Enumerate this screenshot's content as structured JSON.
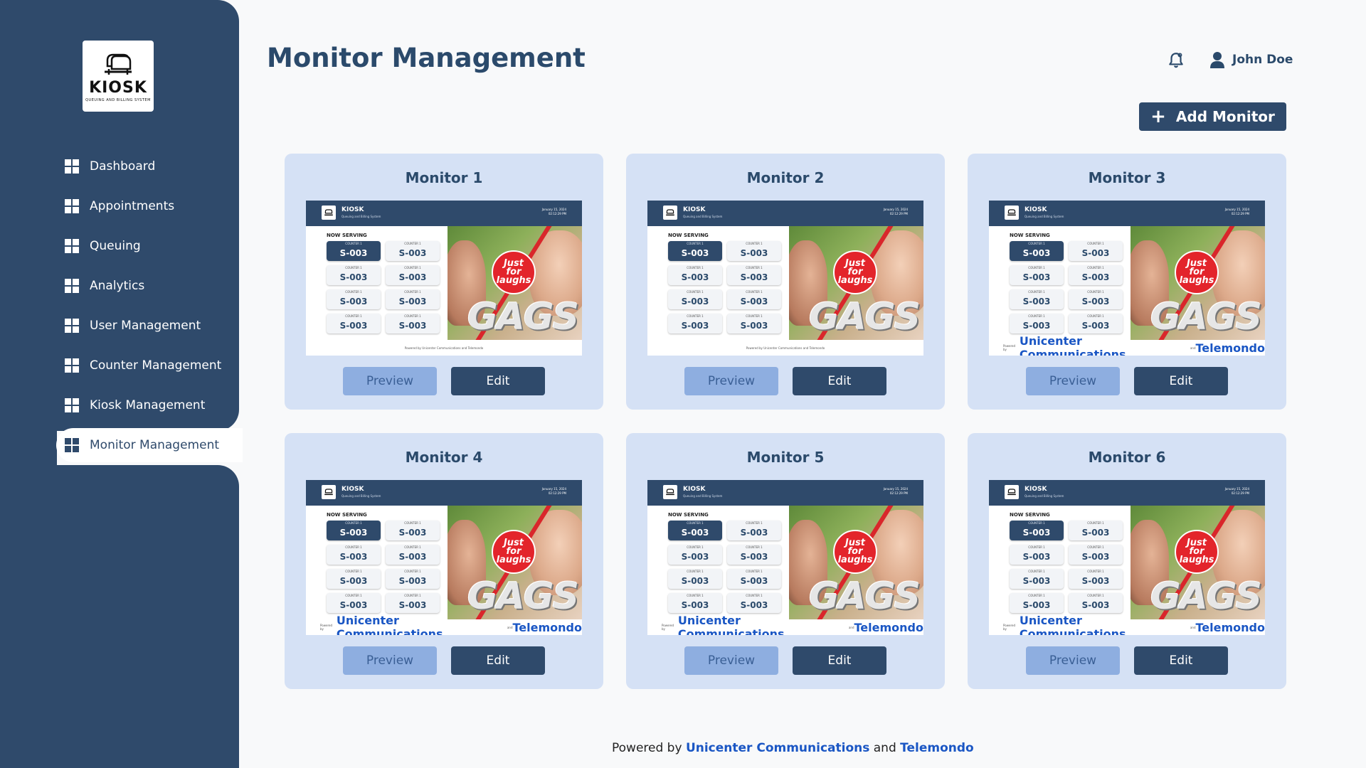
{
  "logo": {
    "word": "KIOSK",
    "tagline": "QUEUING AND BILLING SYSTEM"
  },
  "sidebar": {
    "items": [
      {
        "label": "Dashboard",
        "icon": "grid-icon"
      },
      {
        "label": "Appointments",
        "icon": "grid-icon"
      },
      {
        "label": "Queuing",
        "icon": "grid-icon"
      },
      {
        "label": "Analytics",
        "icon": "grid-icon"
      },
      {
        "label": "User Management",
        "icon": "grid-icon"
      },
      {
        "label": "Counter Management",
        "icon": "grid-icon"
      },
      {
        "label": "Kiosk Management",
        "icon": "grid-icon"
      },
      {
        "label": "Monitor Management",
        "icon": "grid-icon",
        "active": true
      }
    ]
  },
  "header": {
    "title": "Monitor Management",
    "user_name": "John Doe",
    "add_button": "Add Monitor"
  },
  "monitor_preview": {
    "brand": "KIOSK",
    "brand_sub": "Queuing and Billing System",
    "date": "January 15, 2024",
    "time": "02:12:29 PM",
    "now_serving": "NOW SERVING",
    "counter_label": "COUNTER 1",
    "ticket": "S-003",
    "ad_text_1": "Just",
    "ad_text_2": "for",
    "ad_text_3": "laughs",
    "ad_brand": "GAGS",
    "footer_small": "Powered by Unicenter Communications and Telemondo",
    "footer_powered": "Powered by",
    "footer_company1": "Unicenter Communications",
    "footer_and": "and",
    "footer_company2": "Telemondo"
  },
  "monitors": [
    {
      "title": "Monitor 1",
      "preview": "Preview",
      "edit": "Edit"
    },
    {
      "title": "Monitor 2",
      "preview": "Preview",
      "edit": "Edit"
    },
    {
      "title": "Monitor 3",
      "preview": "Preview",
      "edit": "Edit"
    },
    {
      "title": "Monitor 4",
      "preview": "Preview",
      "edit": "Edit"
    },
    {
      "title": "Monitor 5",
      "preview": "Preview",
      "edit": "Edit"
    },
    {
      "title": "Monitor 6",
      "preview": "Preview",
      "edit": "Edit"
    }
  ],
  "footer": {
    "powered": "Powered by",
    "company1": "Unicenter Communications",
    "and": "and",
    "company2": "Telemondo"
  },
  "colors": {
    "sidebar": "#2f4a6b",
    "card": "#d5e1f5",
    "preview_button": "#8eaee0",
    "link": "#1a56c4"
  }
}
